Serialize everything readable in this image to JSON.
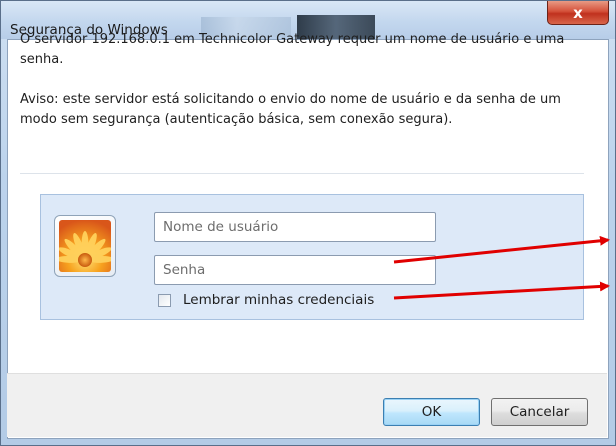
{
  "window": {
    "title": "Segurança do Windows",
    "close_label": "x"
  },
  "message": {
    "line1": "O servidor 192.168.0.1 em Technicolor Gateway requer um nome de usuário e uma senha.",
    "line2": "Aviso: este servidor está solicitando o envio do nome de usuário e da senha de um modo sem segurança (autenticação básica, sem conexão segura)."
  },
  "credentials": {
    "username_placeholder": "Nome de usuário",
    "password_placeholder": "Senha",
    "remember_label": "Lembrar minhas credenciais",
    "remember_checked": false,
    "user_tile_icon": "flower-user-icon"
  },
  "buttons": {
    "ok_label": "OK",
    "cancel_label": "Cancelar"
  },
  "annotations": {
    "arrow_color": "#e00000"
  },
  "colors": {
    "panel_bg": "#dde9f8",
    "close_button": "#c7391f",
    "default_button_border": "#3c7fb1"
  }
}
